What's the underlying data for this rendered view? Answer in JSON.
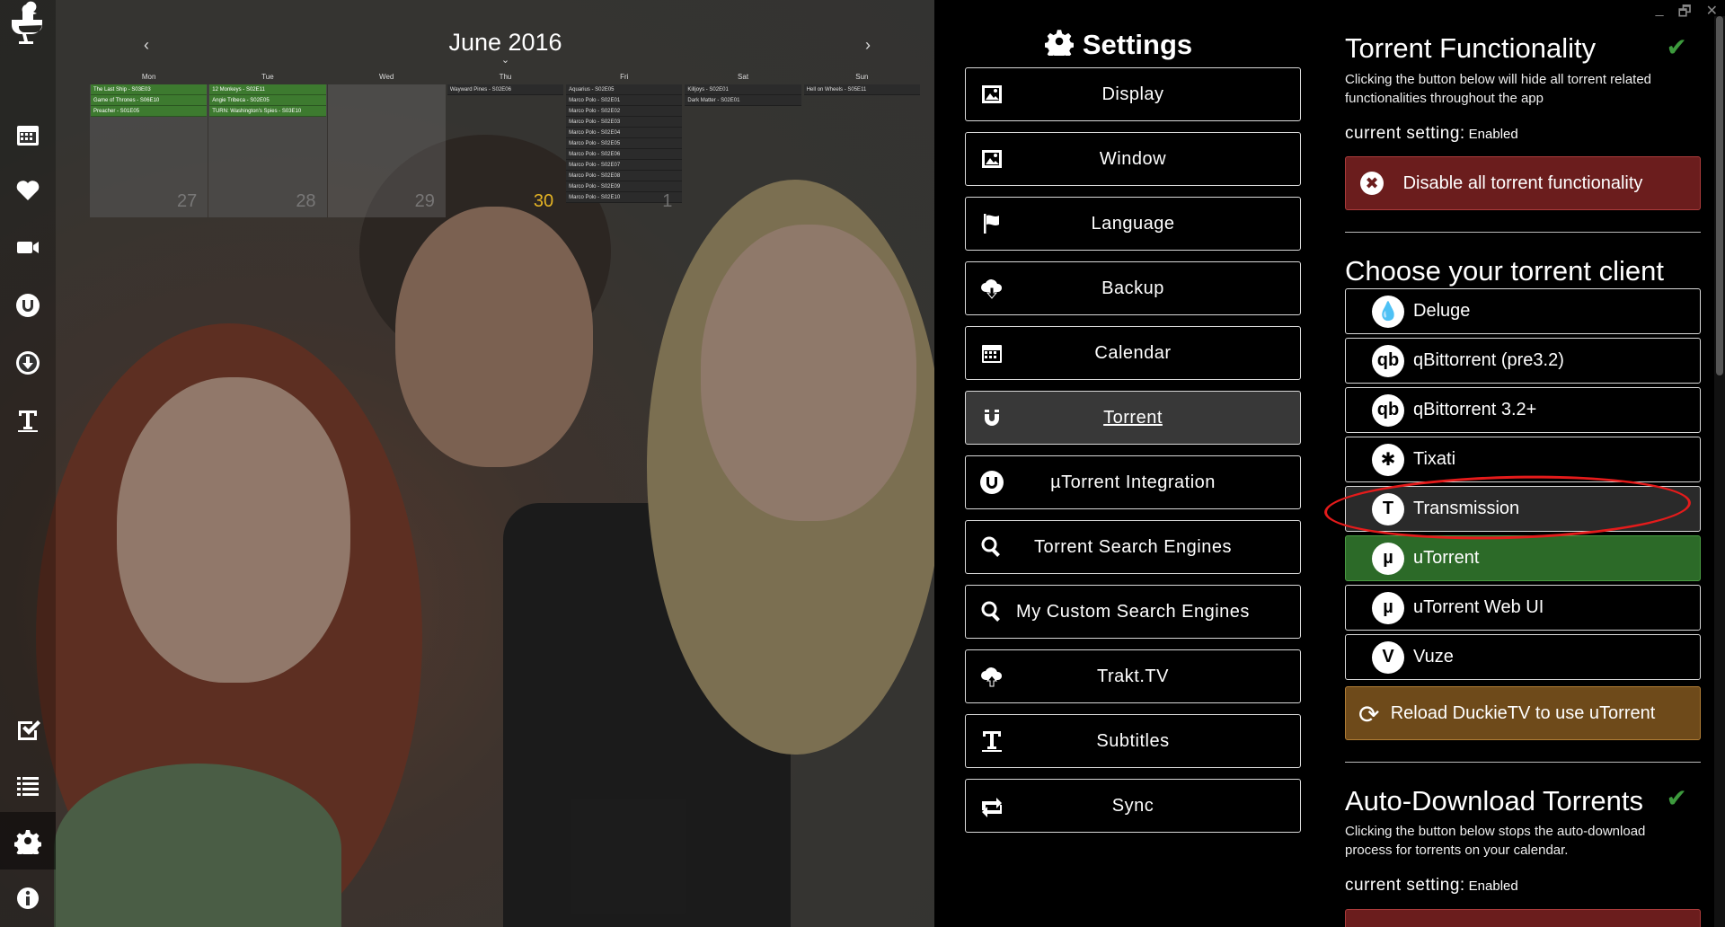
{
  "window": {
    "minimize": "_",
    "maximize": "🗗",
    "close": "✕"
  },
  "sidebar": {
    "items": [
      {
        "name": "logo",
        "icon": "duckietv-logo-icon"
      },
      {
        "name": "calendar",
        "icon": "calendar-icon"
      },
      {
        "name": "favorites",
        "icon": "heart-icon"
      },
      {
        "name": "videos",
        "icon": "video-camera-icon"
      },
      {
        "name": "utorrent",
        "icon": "utorrent-icon"
      },
      {
        "name": "downloads",
        "icon": "download-icon"
      },
      {
        "name": "subtitles",
        "icon": "subtitle-icon"
      },
      {
        "name": "watched",
        "icon": "check-square-icon"
      },
      {
        "name": "list",
        "icon": "list-icon"
      },
      {
        "name": "settings",
        "icon": "gear-icon",
        "active": true
      },
      {
        "name": "about",
        "icon": "info-icon"
      }
    ]
  },
  "calendar": {
    "title": "June 2016",
    "prev": "‹",
    "next": "›",
    "caret": "⌄",
    "days": [
      "Mon",
      "Tue",
      "Wed",
      "Thu",
      "Fri",
      "Sat",
      "Sun"
    ],
    "cells": [
      {
        "num": "27",
        "events": [
          {
            "text": "The Last Ship - S03E03",
            "style": "green"
          },
          {
            "text": "Game of Thrones - S06E10",
            "style": "green"
          },
          {
            "text": "Preacher - S01E05",
            "style": "green"
          }
        ]
      },
      {
        "num": "28",
        "events": [
          {
            "text": "12 Monkeys - S02E11",
            "style": "green"
          },
          {
            "text": "Angie Tribeca - S02E05",
            "style": "green"
          },
          {
            "text": "TURN: Washington's Spies - S03E10",
            "style": "green"
          }
        ]
      },
      {
        "num": "29",
        "events": []
      },
      {
        "num": "30",
        "today": true,
        "events": [
          {
            "text": "Wayward Pines - S02E06",
            "style": "dark"
          }
        ]
      },
      {
        "num": "1",
        "events": [
          {
            "text": "Aquarius - S02E05",
            "style": "dark"
          },
          {
            "text": "Marco Polo - S02E01",
            "style": "dark"
          },
          {
            "text": "Marco Polo - S02E02",
            "style": "dark"
          },
          {
            "text": "Marco Polo - S02E03",
            "style": "dark"
          },
          {
            "text": "Marco Polo - S02E04",
            "style": "dark"
          },
          {
            "text": "Marco Polo - S02E05",
            "style": "dark"
          },
          {
            "text": "Marco Polo - S02E06",
            "style": "dark"
          },
          {
            "text": "Marco Polo - S02E07",
            "style": "dark"
          },
          {
            "text": "Marco Polo - S02E08",
            "style": "dark"
          },
          {
            "text": "Marco Polo - S02E09",
            "style": "dark"
          },
          {
            "text": "Marco Polo - S02E10",
            "style": "dark"
          }
        ]
      },
      {
        "num": "",
        "events": [
          {
            "text": "Killjoys - S02E01",
            "style": "dark"
          },
          {
            "text": "Dark Matter - S02E01",
            "style": "dark"
          }
        ]
      },
      {
        "num": "",
        "events": [
          {
            "text": "Hell on Wheels - S05E11",
            "style": "dark"
          }
        ]
      }
    ]
  },
  "settings": {
    "title": "Settings",
    "title_icon": "gear-icon",
    "menu": [
      {
        "label": "Display",
        "icon": "picture-icon"
      },
      {
        "label": "Window",
        "icon": "picture-icon"
      },
      {
        "label": "Language",
        "icon": "flag-icon"
      },
      {
        "label": "Backup",
        "icon": "cloud-download-icon"
      },
      {
        "label": "Calendar",
        "icon": "calendar-icon"
      },
      {
        "label": "Torrent",
        "icon": "magnet-icon",
        "active": true
      },
      {
        "label": "µTorrent Integration",
        "icon": "utorrent-icon"
      },
      {
        "label": "Torrent Search Engines",
        "icon": "search-icon"
      },
      {
        "label": "My Custom Search Engines",
        "icon": "search-icon"
      },
      {
        "label": "Trakt.TV",
        "icon": "cloud-upload-icon"
      },
      {
        "label": "Subtitles",
        "icon": "subtitle-icon"
      },
      {
        "label": "Sync",
        "icon": "sync-icon"
      }
    ]
  },
  "panel": {
    "torrent_functionality": {
      "title": "Torrent Functionality",
      "check": "✔",
      "description": "Clicking the button below will hide all torrent related functionalities throughout the app",
      "current_label": "current setting:",
      "current_value": "Enabled",
      "button_label": "Disable all torrent functionality",
      "button_icon": "✖"
    },
    "client_section": {
      "title": "Choose your torrent client",
      "clients": [
        {
          "label": "Deluge",
          "icon": "deluge-icon",
          "glyph": "💧"
        },
        {
          "label": "qBittorrent (pre3.2)",
          "icon": "qbittorrent-icon",
          "glyph": "qb"
        },
        {
          "label": "qBittorrent 3.2+",
          "icon": "qbittorrent-icon",
          "glyph": "qb"
        },
        {
          "label": "Tixati",
          "icon": "tixati-icon",
          "glyph": "✱"
        },
        {
          "label": "Transmission",
          "icon": "transmission-icon",
          "glyph": "T",
          "state": "hover"
        },
        {
          "label": "uTorrent",
          "icon": "utorrent-icon",
          "glyph": "µ",
          "state": "active"
        },
        {
          "label": "uTorrent Web UI",
          "icon": "utorrent-icon",
          "glyph": "µ"
        },
        {
          "label": "Vuze",
          "icon": "vuze-icon",
          "glyph": "V"
        }
      ],
      "reload_label": "Reload DuckieTV to use uTorrent",
      "reload_icon": "⟳"
    },
    "auto_download": {
      "title": "Auto-Download Torrents",
      "check": "✔",
      "description": "Clicking the button below stops the auto-download process for torrents on your calendar.",
      "current_label": "current setting:",
      "current_value": "Enabled"
    }
  },
  "colors": {
    "active_green": "#2c6a28",
    "danger_red": "#6b1d1d",
    "warning_orange": "#6e4a1a",
    "today_yellow": "#e4b324",
    "annotation_red": "#e41b1b"
  }
}
